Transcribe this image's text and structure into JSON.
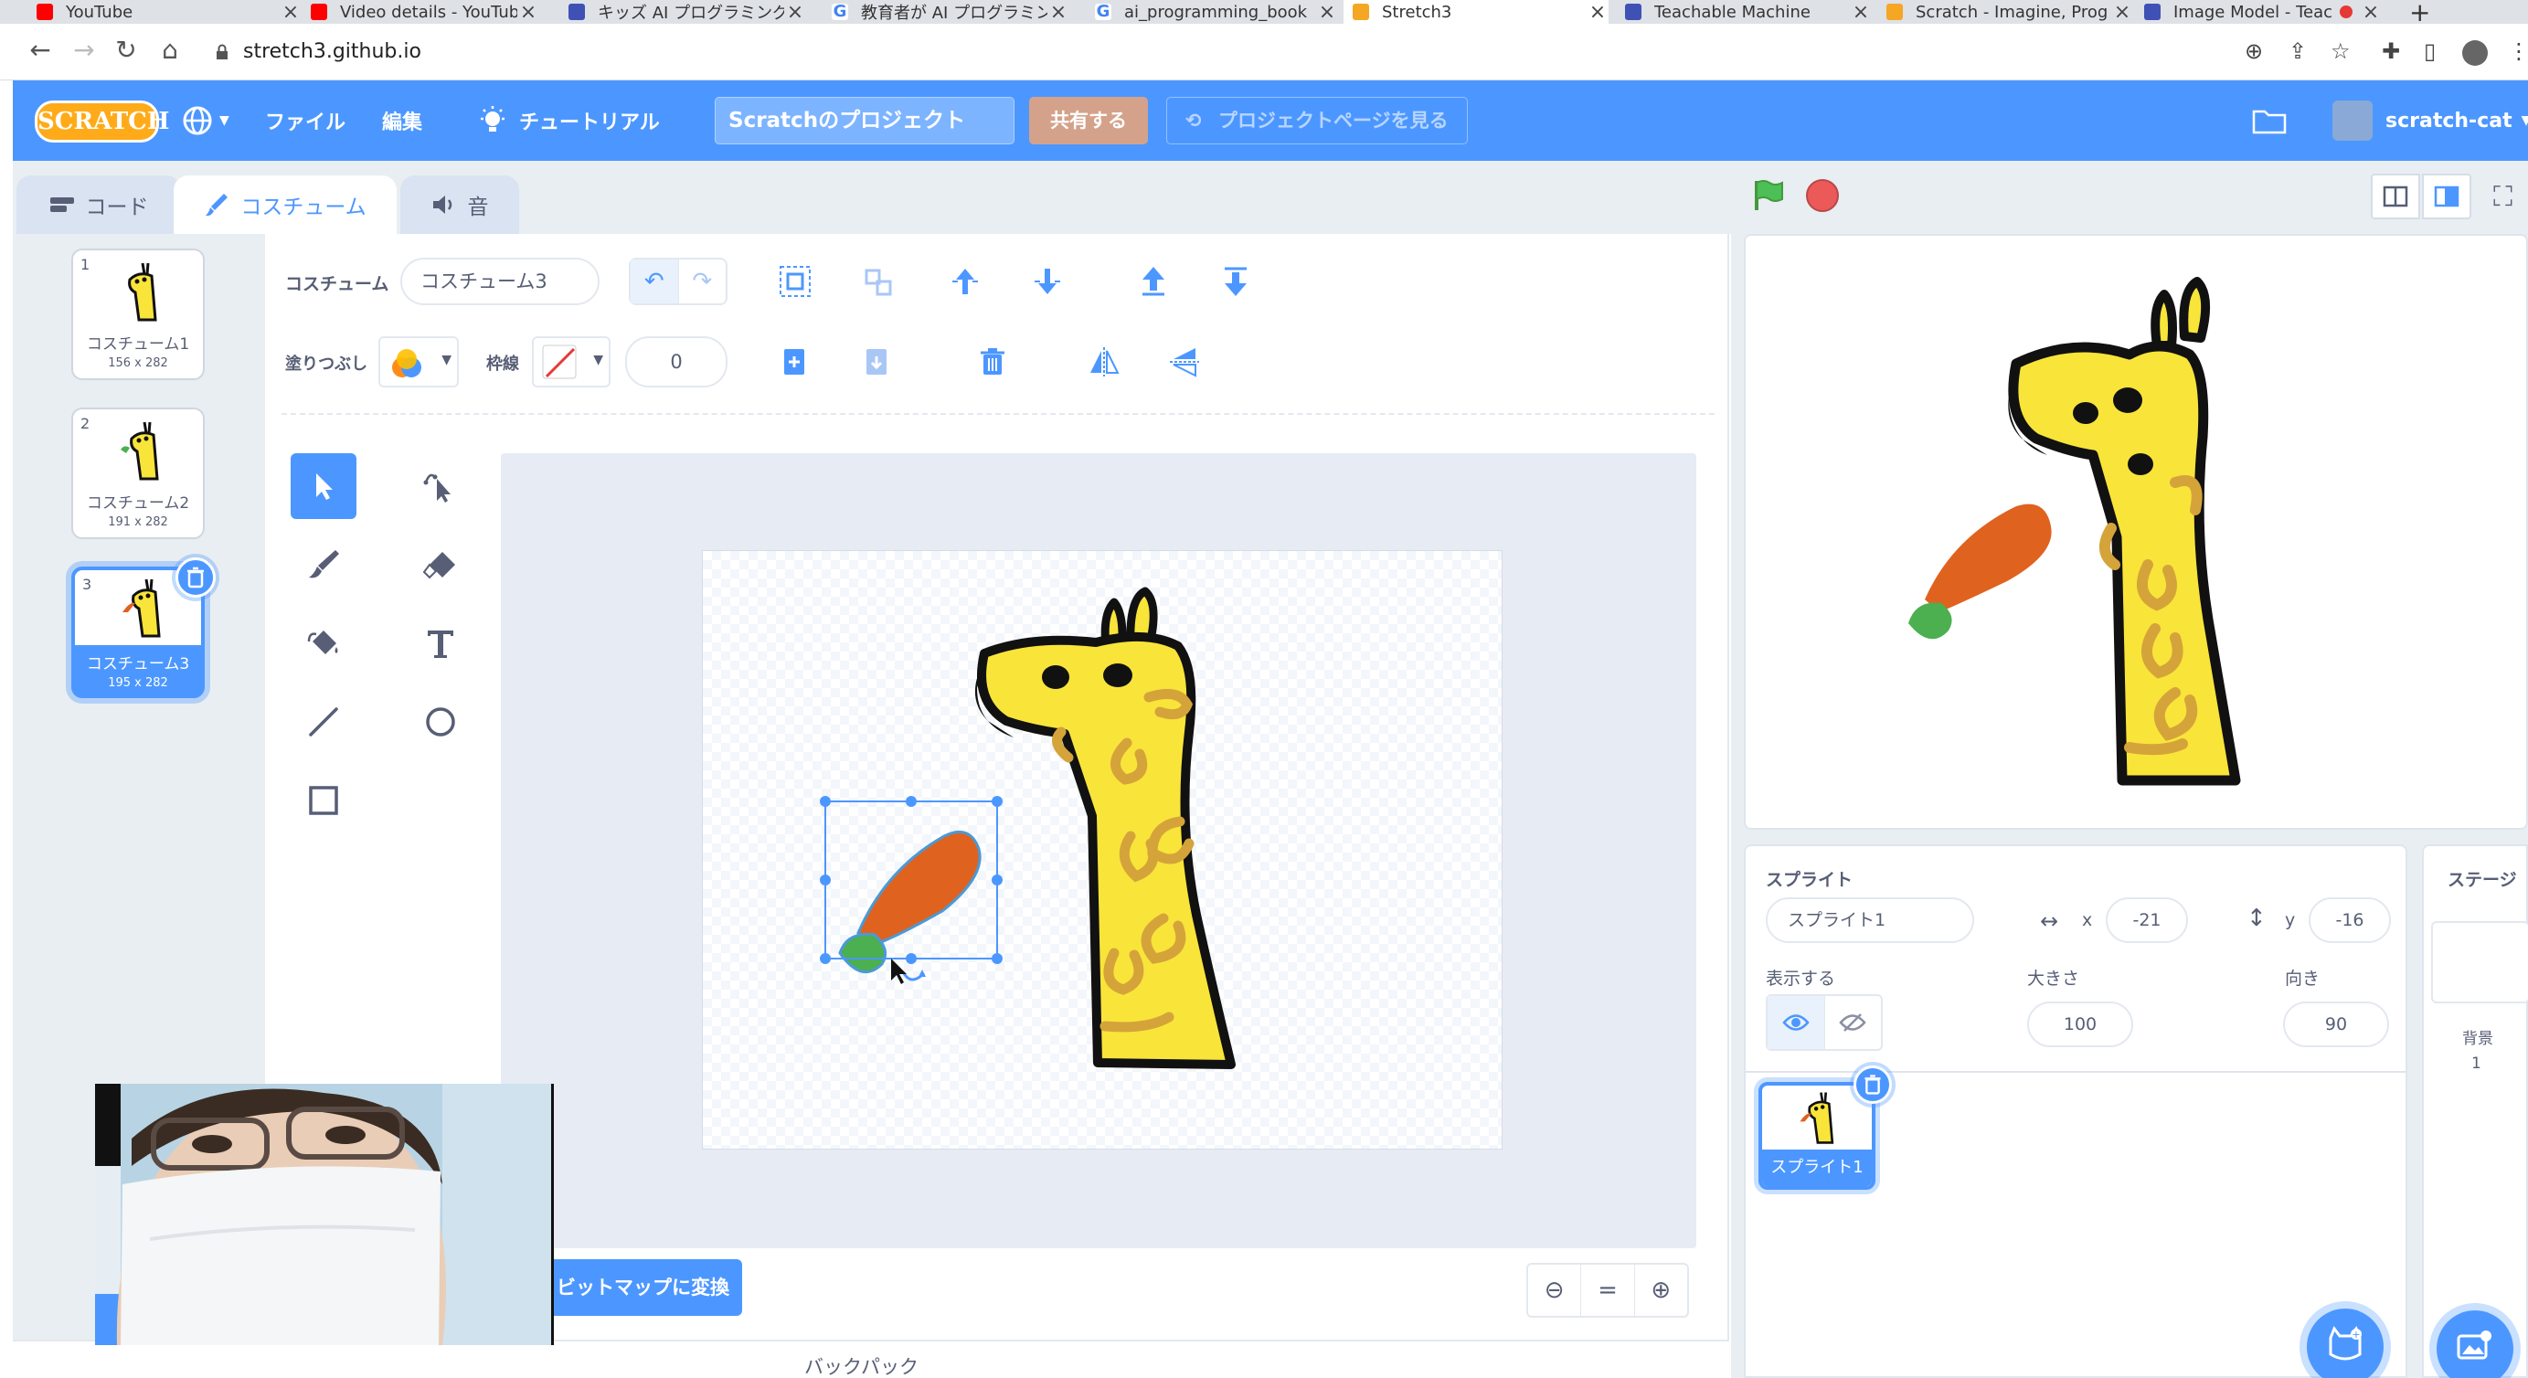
{
  "browser": {
    "tabs": [
      {
        "title": "YouTube",
        "color": "#ff0000"
      },
      {
        "title": "Video details - YouTube",
        "color": "#ff0000"
      },
      {
        "title": "キッズ AI プログラミング",
        "color": "#3f51b5"
      },
      {
        "title": "教育者が AI プログラミン",
        "color": "#4285f4"
      },
      {
        "title": "ai_programming_book",
        "color": "#4285f4"
      },
      {
        "title": "Stretch3",
        "color": "#f5a623"
      },
      {
        "title": "Teachable Machine",
        "color": "#3f51b5"
      },
      {
        "title": "Scratch - Imagine, Prog",
        "color": "#f5a623"
      },
      {
        "title": "Image Model - Teac",
        "color": "#3f51b5"
      }
    ],
    "url": "stretch3.github.io"
  },
  "menu": {
    "logo": "SCRATCH",
    "file": "ファイル",
    "edit": "編集",
    "tutorial": "チュートリアル",
    "project_title": "Scratchのプロジェクト",
    "share": "共有する",
    "see_project_page": "プロジェクトページを見る",
    "username": "scratch-cat"
  },
  "tabs": {
    "code": "コード",
    "costumes": "コスチューム",
    "sounds": "音"
  },
  "costumes": [
    {
      "num": "1",
      "name": "コスチューム1",
      "size": "156 x 282"
    },
    {
      "num": "2",
      "name": "コスチューム2",
      "size": "191 x 282"
    },
    {
      "num": "3",
      "name": "コスチューム3",
      "size": "195 x 282"
    }
  ],
  "paint": {
    "costume_label": "コスチューム",
    "costume_name": "コスチューム3",
    "fill_label": "塗りつぶし",
    "outline_label": "枠線",
    "outline_width": "0",
    "convert_bitmap": "ビットマップに変換",
    "fill_colors": [
      "#ff8c1a",
      "#4c97ff",
      "#ffbf00"
    ]
  },
  "backpack": "バックパック",
  "sprite": {
    "section_label": "スプライト",
    "name": "スプライト1",
    "x_label": "x",
    "x": "-21",
    "y_label": "y",
    "y": "-16",
    "show_label": "表示する",
    "size_label": "大きさ",
    "size": "100",
    "direction_label": "向き",
    "direction": "90",
    "thumb_name": "スプライト1"
  },
  "stage_panel": {
    "label": "ステージ",
    "backdrops_label": "背景",
    "backdrops_count": "1"
  },
  "colors": {
    "scratch_blue": "#4c97ff",
    "giraffe_yellow": "#f9e43a",
    "giraffe_spots": "#d4a43a",
    "carrot_orange": "#e0621f",
    "carrot_green": "#4caf50"
  }
}
